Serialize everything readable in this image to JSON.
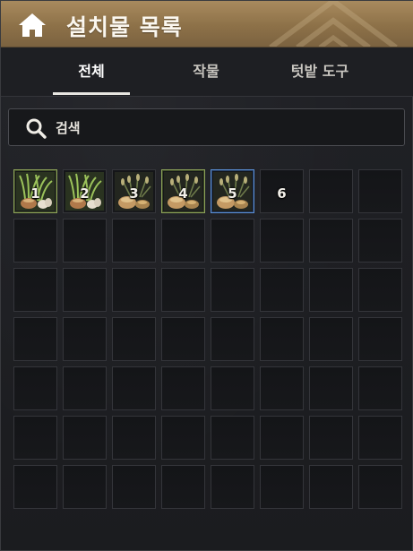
{
  "window": {
    "title": "설치물 목록",
    "accent": "#8d7148"
  },
  "tabs": [
    {
      "label": "전체",
      "active": true
    },
    {
      "label": "작물",
      "active": false
    },
    {
      "label": "텃밭 도구",
      "active": false
    }
  ],
  "search": {
    "placeholder": "검색"
  },
  "grid": {
    "columns": 8,
    "rows": 7,
    "slots": [
      {
        "number": "1",
        "item": "green-onion-seed-bag",
        "highlight": "green"
      },
      {
        "number": "2",
        "item": "green-onion-seed-bag",
        "highlight": "none"
      },
      {
        "number": "3",
        "item": "grain-seed-bag",
        "highlight": "none"
      },
      {
        "number": "4",
        "item": "grain-seed-bag",
        "highlight": "green"
      },
      {
        "number": "5",
        "item": "grain-seed-bag",
        "highlight": "blue"
      },
      {
        "number": "6",
        "item": "",
        "highlight": "none"
      }
    ]
  }
}
